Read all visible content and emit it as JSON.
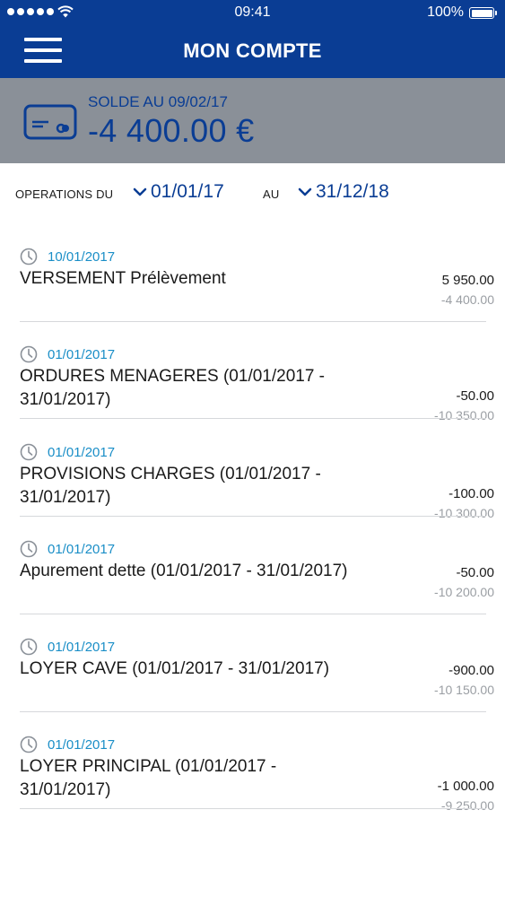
{
  "status_bar": {
    "time": "09:41",
    "battery": "100%"
  },
  "header": {
    "title": "MON COMPTE"
  },
  "balance": {
    "label": "SOLDE AU 09/02/17",
    "amount": "-4 400.00 €"
  },
  "filter": {
    "from_label": "OPERATIONS DU",
    "from_date": "01/01/17",
    "to_label": "AU",
    "to_date": "31/12/18"
  },
  "operations": [
    {
      "date": "10/01/2017",
      "label_line1": "VERSEMENT Prélèvement",
      "label_line2": "",
      "amount": "5 950.00",
      "running": "-4 400.00"
    },
    {
      "date": "01/01/2017",
      "label_line1": "ORDURES MENAGERES (01/01/2017 -",
      "label_line2": "31/01/2017)",
      "amount": "-50.00",
      "running": "-10 350.00"
    },
    {
      "date": "01/01/2017",
      "label_line1": "PROVISIONS CHARGES (01/01/2017 -",
      "label_line2": "31/01/2017)",
      "amount": "-100.00",
      "running": "-10 300.00"
    },
    {
      "date": "01/01/2017",
      "label_line1": "Apurement dette (01/01/2017 - 31/01/2017)",
      "label_line2": "",
      "amount": "-50.00",
      "running": "-10 200.00"
    },
    {
      "date": "01/01/2017",
      "label_line1": "LOYER CAVE (01/01/2017 - 31/01/2017)",
      "label_line2": "",
      "amount": "-900.00",
      "running": "-10 150.00"
    },
    {
      "date": "01/01/2017",
      "label_line1": "LOYER PRINCIPAL (01/01/2017 -",
      "label_line2": "31/01/2017)",
      "amount": "-1 000.00",
      "running": "-9 250.00"
    }
  ],
  "icons": {
    "menu": "hamburger-menu-icon",
    "card": "card-icon",
    "clock": "clock-icon",
    "chevron": "chevron-down-icon"
  },
  "colors": {
    "primary": "#0a3d94",
    "balance_bg": "#8a9098",
    "date_accent": "#1a8ec7",
    "muted": "#9a9ea3"
  }
}
